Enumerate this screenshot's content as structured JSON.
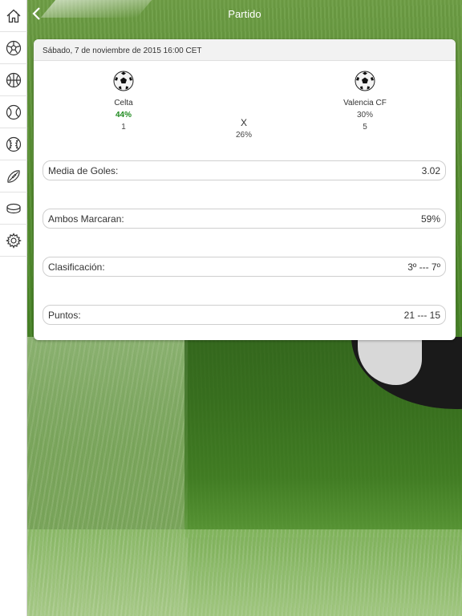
{
  "header": {
    "title": "Partido",
    "back_icon": "chevron-left-icon"
  },
  "sidebar": {
    "items": [
      {
        "id": "home",
        "icon": "home-icon"
      },
      {
        "id": "football",
        "icon": "football-icon"
      },
      {
        "id": "basketball",
        "icon": "basketball-icon"
      },
      {
        "id": "tennis",
        "icon": "tennis-icon"
      },
      {
        "id": "baseball",
        "icon": "baseball-icon"
      },
      {
        "id": "american-football",
        "icon": "american-football-icon"
      },
      {
        "id": "hockey",
        "icon": "hockey-puck-icon"
      },
      {
        "id": "settings",
        "icon": "gear-icon"
      }
    ]
  },
  "match": {
    "date": "Sábado, 7 de noviembre de 2015 16:00 CET",
    "home": {
      "name": "Celta",
      "pct": "44%",
      "position": "1"
    },
    "draw": {
      "label": "X",
      "pct": "26%"
    },
    "away": {
      "name": "Valencia CF",
      "pct": "30%",
      "position": "5"
    }
  },
  "stats": [
    {
      "label": "Media de Goles:",
      "value": "3.02"
    },
    {
      "label": "Ambos Marcaran:",
      "value": "59%"
    },
    {
      "label": "Clasificación:",
      "value": "3º --- 7º"
    },
    {
      "label": "Puntos:",
      "value": "21 --- 15"
    }
  ],
  "colors": {
    "win_pct": "#1f8a1f",
    "title_text": "#ffffff"
  }
}
